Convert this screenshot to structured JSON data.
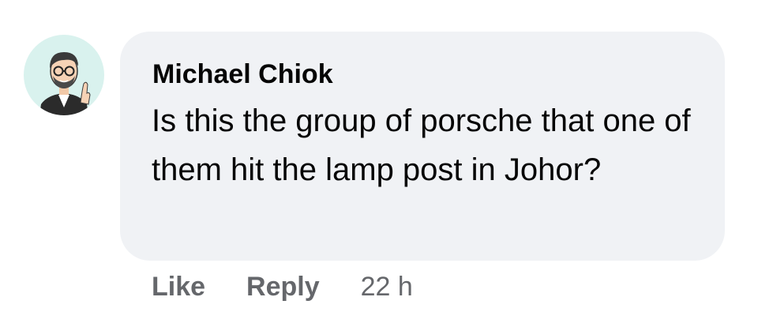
{
  "comment": {
    "author": "Michael Chiok",
    "text": "Is this the group of porsche that one of them hit the lamp post in Johor?",
    "avatar_icon": "cartoon-man-avatar-icon",
    "avatar_bg": "#d9f2ee",
    "bubble_bg": "#f0f2f5"
  },
  "actions": {
    "like_label": "Like",
    "reply_label": "Reply",
    "timestamp": "22 h"
  }
}
